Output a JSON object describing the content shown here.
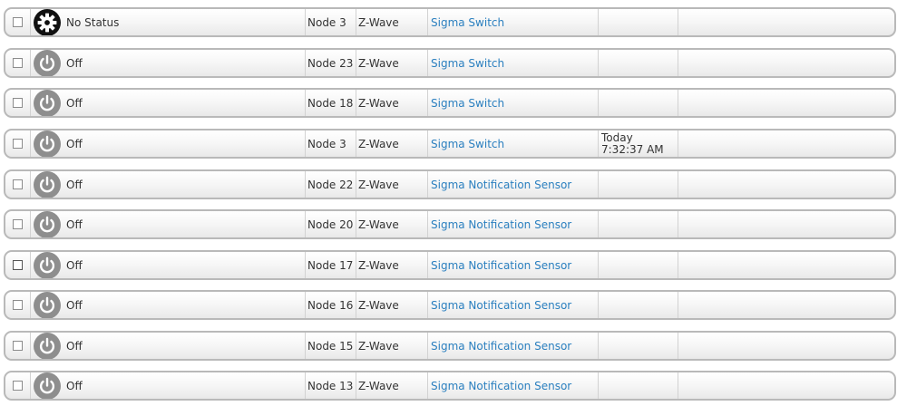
{
  "devices": [
    {
      "status": "No Status",
      "icon": "gear-icon",
      "node": "Node 3",
      "type": "Z-Wave",
      "device": "Sigma Switch",
      "time": ""
    },
    {
      "status": "Off",
      "icon": "power-icon",
      "node": "Node 23",
      "type": "Z-Wave",
      "device": "Sigma Switch",
      "time": ""
    },
    {
      "status": "Off",
      "icon": "power-icon",
      "node": "Node 18",
      "type": "Z-Wave",
      "device": "Sigma Switch",
      "time": ""
    },
    {
      "status": "Off",
      "icon": "power-icon",
      "node": "Node 3",
      "type": "Z-Wave",
      "device": "Sigma Switch",
      "time": "Today\n7:32:37 AM"
    },
    {
      "status": "Off",
      "icon": "power-icon",
      "node": "Node 22",
      "type": "Z-Wave",
      "device": "Sigma Notification Sensor",
      "time": ""
    },
    {
      "status": "Off",
      "icon": "power-icon",
      "node": "Node 20",
      "type": "Z-Wave",
      "device": "Sigma Notification Sensor",
      "time": ""
    },
    {
      "status": "Off",
      "icon": "power-icon",
      "node": "Node 17",
      "type": "Z-Wave",
      "device": "Sigma Notification Sensor",
      "time": ""
    },
    {
      "status": "Off",
      "icon": "power-icon",
      "node": "Node 16",
      "type": "Z-Wave",
      "device": "Sigma Notification Sensor",
      "time": ""
    },
    {
      "status": "Off",
      "icon": "power-icon",
      "node": "Node 15",
      "type": "Z-Wave",
      "device": "Sigma Notification Sensor",
      "time": ""
    },
    {
      "status": "Off",
      "icon": "power-icon",
      "node": "Node 13",
      "type": "Z-Wave",
      "device": "Sigma Notification Sensor",
      "time": ""
    }
  ]
}
